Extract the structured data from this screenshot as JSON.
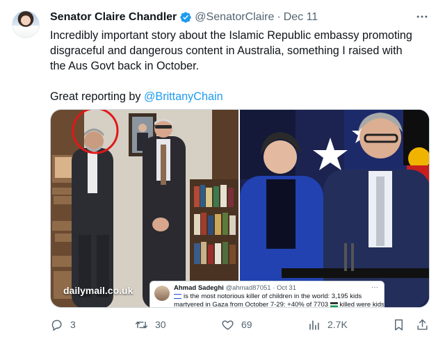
{
  "tweet": {
    "author_name": "Senator Claire Chandler",
    "handle": "@SenatorClaire",
    "separator": "·",
    "date": "Dec 11",
    "more_icon": "ellipsis-icon",
    "verified_color": "#1d9bf0",
    "text_lines": [
      "Incredibly important story about the Islamic Republic embassy promoting",
      "disgraceful and dangerous content in Australia, something I raised with",
      "the Aus Govt back in October."
    ],
    "reporting_prefix": "Great reporting by ",
    "mention": "@BrittanyChain"
  },
  "media": {
    "left_caption": "dailymail.co.uk",
    "embedded_tweet": {
      "author": "Ahmad Sadeghi",
      "handle": "@ahmad87051",
      "date": "· Oct 31",
      "line1": "is the most notorious killer of children in the world: 3,195 kids",
      "line2": "martyered in Gaza from October 7-29: +40% of 7703",
      "line2_end": "killed were kids:"
    }
  },
  "actions": {
    "reply_count": "3",
    "retweet_count": "30",
    "like_count": "69",
    "views_count": "2.7K"
  },
  "colors": {
    "text": "#0f1419",
    "secondary": "#536471",
    "link": "#1d9bf0",
    "border": "#cfd9de"
  }
}
